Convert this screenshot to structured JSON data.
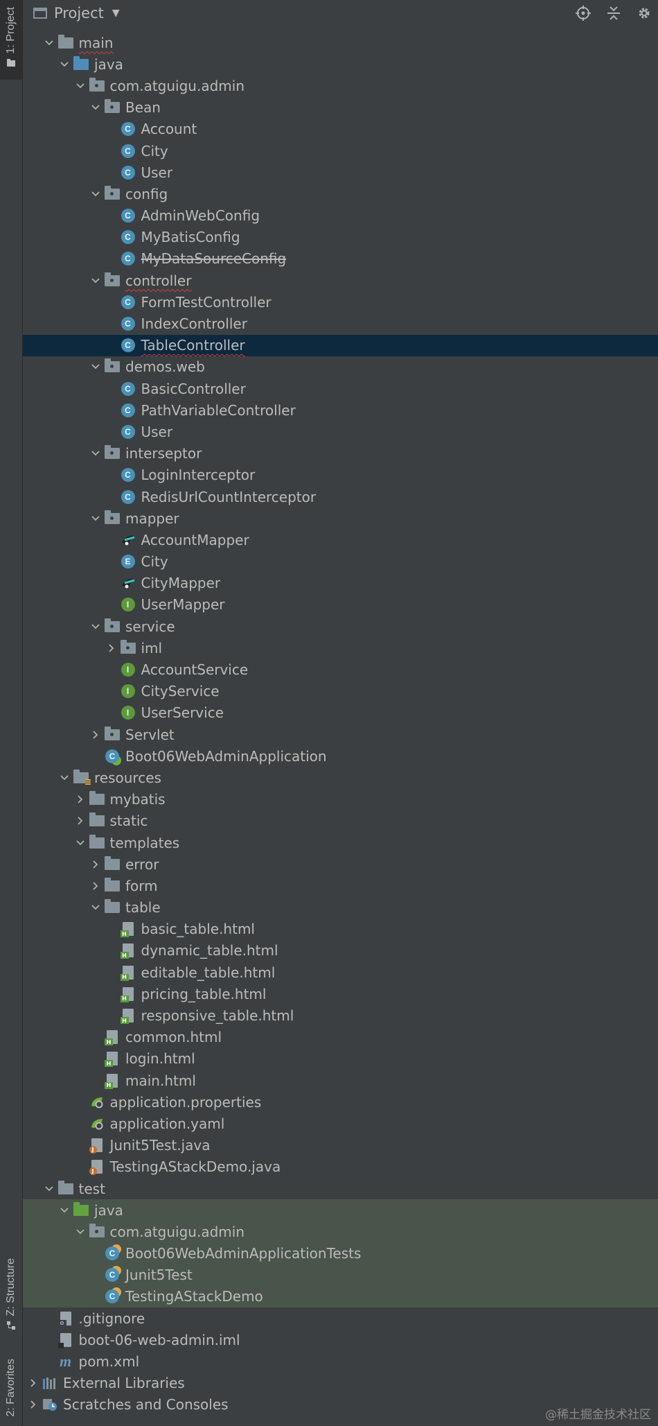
{
  "sidebar": {
    "project_tab": "1: Project",
    "structure_tab": "Z: Structure",
    "favorites_tab": "2: Favorites"
  },
  "toolbar": {
    "title": "Project",
    "tools": [
      "locate-icon",
      "collapse-all-icon",
      "settings-icon"
    ]
  },
  "tree": [
    {
      "label": "main",
      "depth": 2,
      "arrow": "down",
      "icon": "folder",
      "squiggle": true
    },
    {
      "label": "java",
      "depth": 3,
      "arrow": "down",
      "icon": "folder-blue"
    },
    {
      "label": "com.atguigu.admin",
      "depth": 4,
      "arrow": "down",
      "icon": "package"
    },
    {
      "label": "Bean",
      "depth": 5,
      "arrow": "down",
      "icon": "package"
    },
    {
      "label": "Account",
      "depth": 6,
      "icon": "class"
    },
    {
      "label": "City",
      "depth": 6,
      "icon": "class"
    },
    {
      "label": "User",
      "depth": 6,
      "icon": "class"
    },
    {
      "label": "config",
      "depth": 5,
      "arrow": "down",
      "icon": "package"
    },
    {
      "label": "AdminWebConfig",
      "depth": 6,
      "icon": "class"
    },
    {
      "label": "MyBatisConfig",
      "depth": 6,
      "icon": "class"
    },
    {
      "label": "MyDataSourceConfig",
      "depth": 6,
      "icon": "class",
      "strike": true
    },
    {
      "label": "controller",
      "depth": 5,
      "arrow": "down",
      "icon": "package",
      "squiggle": true
    },
    {
      "label": "FormTestController",
      "depth": 6,
      "icon": "class"
    },
    {
      "label": "IndexController",
      "depth": 6,
      "icon": "class"
    },
    {
      "label": "TableController",
      "depth": 6,
      "icon": "class",
      "selected": true,
      "squiggle": true
    },
    {
      "label": "demos.web",
      "depth": 5,
      "arrow": "down",
      "icon": "package"
    },
    {
      "label": "BasicController",
      "depth": 6,
      "icon": "class"
    },
    {
      "label": "PathVariableController",
      "depth": 6,
      "icon": "class"
    },
    {
      "label": "User",
      "depth": 6,
      "icon": "class"
    },
    {
      "label": "interseptor",
      "depth": 5,
      "arrow": "down",
      "icon": "package"
    },
    {
      "label": "LoginInterceptor",
      "depth": 6,
      "icon": "class"
    },
    {
      "label": "RedisUrlCountInterceptor",
      "depth": 6,
      "icon": "class"
    },
    {
      "label": "mapper",
      "depth": 5,
      "arrow": "down",
      "icon": "package"
    },
    {
      "label": "AccountMapper",
      "depth": 6,
      "icon": "mybatis"
    },
    {
      "label": "City",
      "depth": 6,
      "icon": "enum"
    },
    {
      "label": "CityMapper",
      "depth": 6,
      "icon": "mybatis"
    },
    {
      "label": "UserMapper",
      "depth": 6,
      "icon": "interface"
    },
    {
      "label": "service",
      "depth": 5,
      "arrow": "down",
      "icon": "package"
    },
    {
      "label": "iml",
      "depth": 6,
      "arrow": "right",
      "icon": "package"
    },
    {
      "label": "AccountService",
      "depth": 6,
      "icon": "interface"
    },
    {
      "label": "CityService",
      "depth": 6,
      "icon": "interface"
    },
    {
      "label": "UserService",
      "depth": 6,
      "icon": "interface"
    },
    {
      "label": "Servlet",
      "depth": 5,
      "arrow": "right",
      "icon": "package"
    },
    {
      "label": "Boot06WebAdminApplication",
      "depth": 5,
      "icon": "spring-class"
    },
    {
      "label": "resources",
      "depth": 3,
      "arrow": "down",
      "icon": "resources"
    },
    {
      "label": "mybatis",
      "depth": 4,
      "arrow": "right",
      "icon": "folder"
    },
    {
      "label": "static",
      "depth": 4,
      "arrow": "right",
      "icon": "folder"
    },
    {
      "label": "templates",
      "depth": 4,
      "arrow": "down",
      "icon": "folder"
    },
    {
      "label": "error",
      "depth": 5,
      "arrow": "right",
      "icon": "folder"
    },
    {
      "label": "form",
      "depth": 5,
      "arrow": "right",
      "icon": "folder"
    },
    {
      "label": "table",
      "depth": 5,
      "arrow": "down",
      "icon": "folder"
    },
    {
      "label": "basic_table.html",
      "depth": 6,
      "icon": "html"
    },
    {
      "label": "dynamic_table.html",
      "depth": 6,
      "icon": "html"
    },
    {
      "label": "editable_table.html",
      "depth": 6,
      "icon": "html"
    },
    {
      "label": "pricing_table.html",
      "depth": 6,
      "icon": "html"
    },
    {
      "label": "responsive_table.html",
      "depth": 6,
      "icon": "html"
    },
    {
      "label": "common.html",
      "depth": 5,
      "icon": "html"
    },
    {
      "label": "login.html",
      "depth": 5,
      "icon": "html"
    },
    {
      "label": "main.html",
      "depth": 5,
      "icon": "html"
    },
    {
      "label": "application.properties",
      "depth": 4,
      "icon": "spring-config"
    },
    {
      "label": "application.yaml",
      "depth": 4,
      "icon": "spring-config"
    },
    {
      "label": "Junit5Test.java",
      "depth": 4,
      "icon": "java-file"
    },
    {
      "label": "TestingAStackDemo.java",
      "depth": 4,
      "icon": "java-file"
    },
    {
      "label": "test",
      "depth": 2,
      "arrow": "down",
      "icon": "folder"
    },
    {
      "label": "java",
      "depth": 3,
      "arrow": "down",
      "icon": "folder-green",
      "testbg": true
    },
    {
      "label": "com.atguigu.admin",
      "depth": 4,
      "arrow": "down",
      "icon": "package",
      "testbg": true
    },
    {
      "label": "Boot06WebAdminApplicationTests",
      "depth": 5,
      "icon": "test-class",
      "testbg": true
    },
    {
      "label": "Junit5Test",
      "depth": 5,
      "icon": "test-class",
      "testbg": true
    },
    {
      "label": "TestingAStackDemo",
      "depth": 5,
      "icon": "test-class",
      "testbg": true
    },
    {
      "label": ".gitignore",
      "depth": 2,
      "icon": "ignore-file"
    },
    {
      "label": "boot-06-web-admin.iml",
      "depth": 2,
      "icon": "iml-file"
    },
    {
      "label": "pom.xml",
      "depth": 2,
      "icon": "maven"
    },
    {
      "label": "External Libraries",
      "depth": 1,
      "arrow": "right",
      "icon": "libraries"
    },
    {
      "label": "Scratches and Consoles",
      "depth": 1,
      "arrow": "right",
      "icon": "scratches"
    }
  ],
  "watermark": "@稀土掘金技术社区",
  "colors": {
    "background": "#3c3f41",
    "selection": "#0d293e",
    "test_source": "#49544a",
    "class_icon": "#4a91b7",
    "interface_icon": "#5e9a3c"
  }
}
